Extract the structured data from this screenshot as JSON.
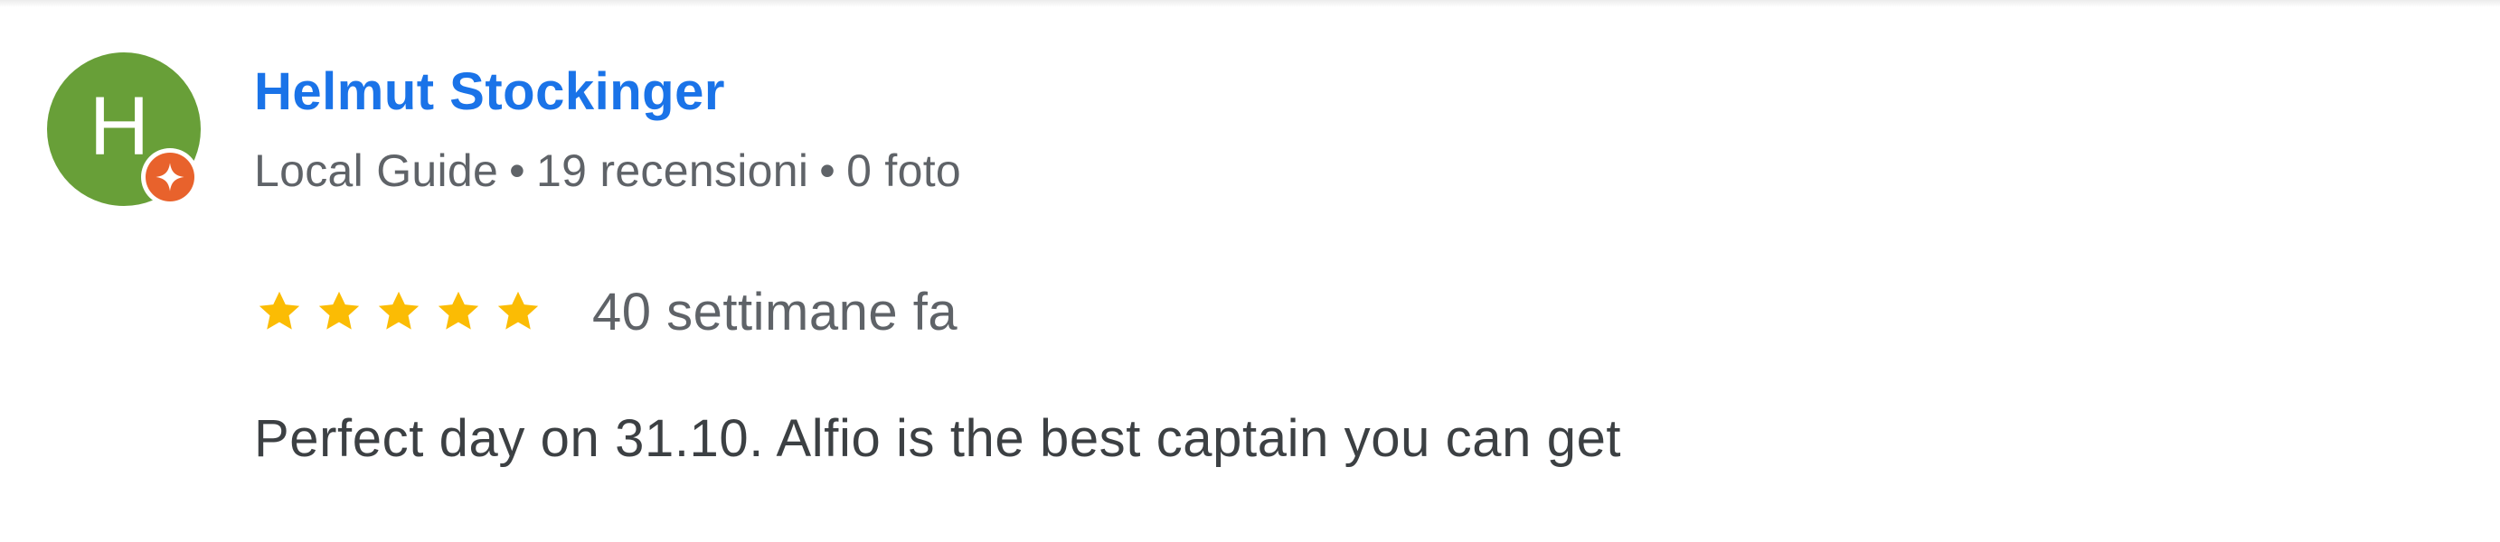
{
  "review": {
    "reviewer": {
      "initial": "H",
      "name": "Helmut Stockinger",
      "avatar_color": "#689f38",
      "badge_icon": "local-guide-star-icon",
      "badge_color": "#e8622c",
      "level": "Local Guide",
      "reviews_count": "19 recensioni",
      "photos_count": "0 foto",
      "separator": "•"
    },
    "rating": {
      "stars": 5,
      "max_stars": 5,
      "star_color": "#fbbc04",
      "icon": "star-icon"
    },
    "date": "40 settimane fa",
    "text": "Perfect day on 31.10. Alfio is the best captain you can get",
    "name_color": "#1a73e8"
  }
}
